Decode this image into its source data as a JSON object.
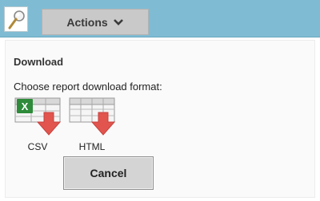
{
  "toolbar": {
    "search_icon": "magnifier-icon",
    "actions_label": "Actions",
    "actions_icon": "chevron-down-icon"
  },
  "dialog": {
    "heading": "Download",
    "prompt": "Choose report download format:",
    "formats": [
      {
        "label": "CSV",
        "icon": "excel-download-icon"
      },
      {
        "label": "HTML",
        "icon": "table-download-icon"
      }
    ],
    "cancel_label": "Cancel"
  },
  "colors": {
    "toolbar_bg": "#7fbcd4",
    "button_bg": "#c9c9c9",
    "arrow_red": "#e2554f",
    "excel_green": "#2e8b3a"
  }
}
